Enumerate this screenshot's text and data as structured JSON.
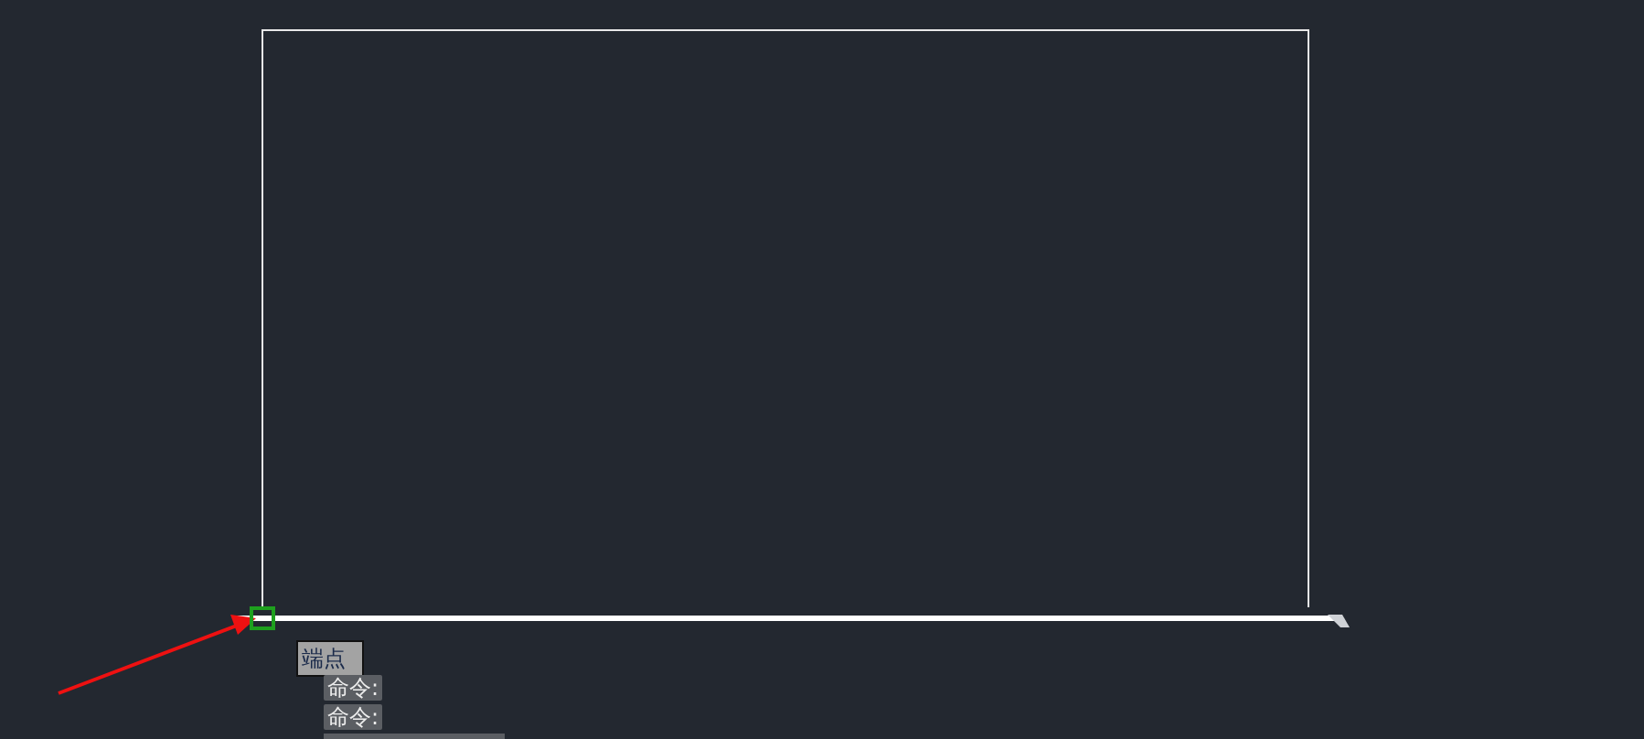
{
  "snap_tooltip": {
    "label": "端点"
  },
  "command_history": [
    {
      "text": "命令:"
    },
    {
      "text": "命令:"
    }
  ]
}
